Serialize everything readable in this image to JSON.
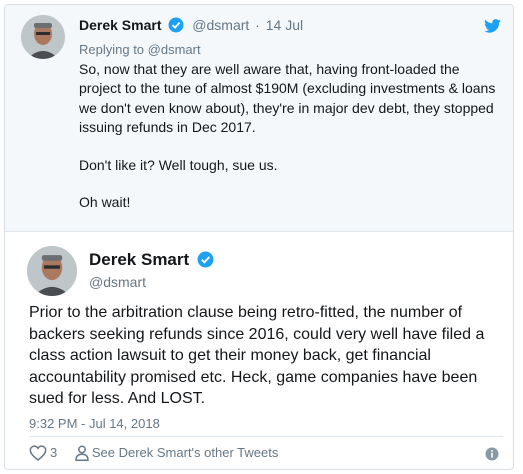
{
  "parent_tweet": {
    "name": "Derek Smart",
    "handle": "@dsmart",
    "separator": "·",
    "date": "14 Jul",
    "replying_to_prefix": "Replying to",
    "replying_to_handle": "@dsmart",
    "paragraphs": [
      "So, now that they are well aware that, having front-loaded the project to the tune of almost $190M (excluding investments & loans we don't even know about), they're in major dev debt, they stopped issuing refunds in Dec 2017.",
      "Don't like it? Well tough, sue us.",
      "Oh wait!"
    ]
  },
  "main_tweet": {
    "name": "Derek Smart",
    "handle": "@dsmart",
    "text": "Prior to the arbitration clause being retro-fitted, the number of backers seeking refunds since 2016, could very well have filed a class action lawsuit to get their money back, get financial accountability promised etc. Heck, game companies have been sued for less. And LOST.",
    "timestamp": "9:32 PM - Jul 14, 2018",
    "likes": "3",
    "profile_link": "See Derek Smart's other Tweets"
  },
  "icons": {
    "verified": "verified-badge-icon",
    "twitter": "twitter-bird-icon",
    "like": "heart-icon",
    "profile": "person-icon",
    "info": "info-icon"
  },
  "colors": {
    "verified_blue": "#1da1f2",
    "muted_text": "#657786",
    "parent_background": "#f5f8fa"
  }
}
